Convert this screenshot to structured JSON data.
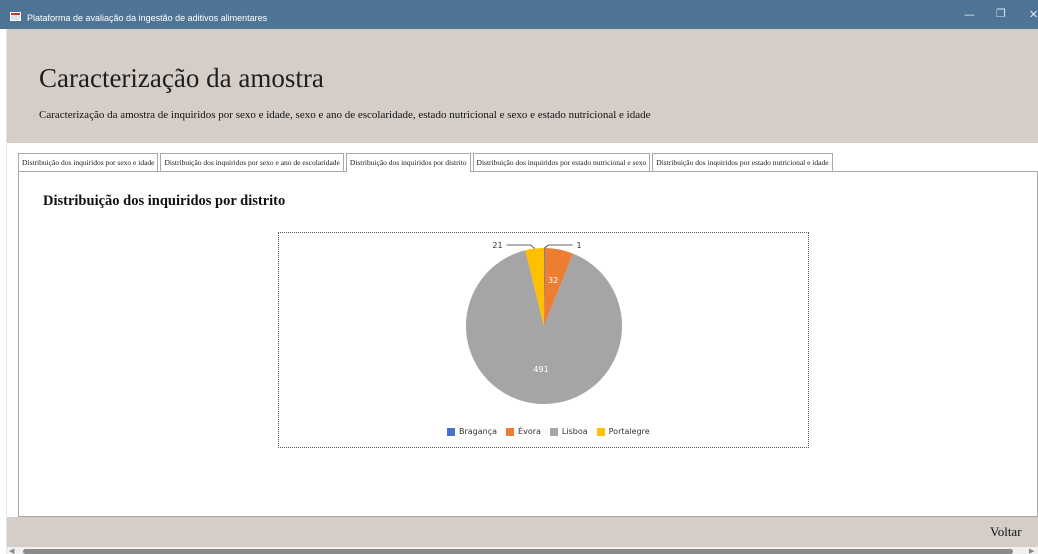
{
  "window": {
    "title": "Plataforma de avaliação da ingestão de aditivos alimentares",
    "minimize_glyph": "—",
    "restore_glyph": "❐",
    "close_glyph": "✕"
  },
  "header": {
    "title": "Caracterização da amostra",
    "subtitle": "Caracterização da amostra de inquiridos por sexo e idade, sexo e ano de escolaridade, estado nutricional e sexo e estado nutricional e idade"
  },
  "tabs": [
    {
      "label": "Distribuição dos inquiridos por sexo e idade",
      "active": false
    },
    {
      "label": "Distribuição dos inquiridos por sexo e ano de escolaridade",
      "active": false
    },
    {
      "label": "Distribuição dos inquiridos por distrito",
      "active": true
    },
    {
      "label": "Distribuição dos inquiridos por estado nutricional e sexo",
      "active": false
    },
    {
      "label": "Distribuição dos inquiridos por estado nutricional e idade",
      "active": false
    }
  ],
  "section": {
    "title": "Distribuição dos inquiridos por distrito"
  },
  "chart_data": {
    "type": "pie",
    "title": "",
    "categories": [
      "Bragança",
      "Évora",
      "Lisboa",
      "Portalegre"
    ],
    "values": [
      1,
      32,
      491,
      21
    ],
    "data_labels": [
      "1",
      "32",
      "491",
      "21"
    ],
    "colors": [
      "#4472c4",
      "#ed7d31",
      "#a5a5a5",
      "#ffc000"
    ],
    "legend_position": "bottom"
  },
  "footer": {
    "back_label": "Voltar"
  },
  "colors": {
    "titlebar": "#4f7596",
    "header_bg": "#d5cdc7"
  }
}
